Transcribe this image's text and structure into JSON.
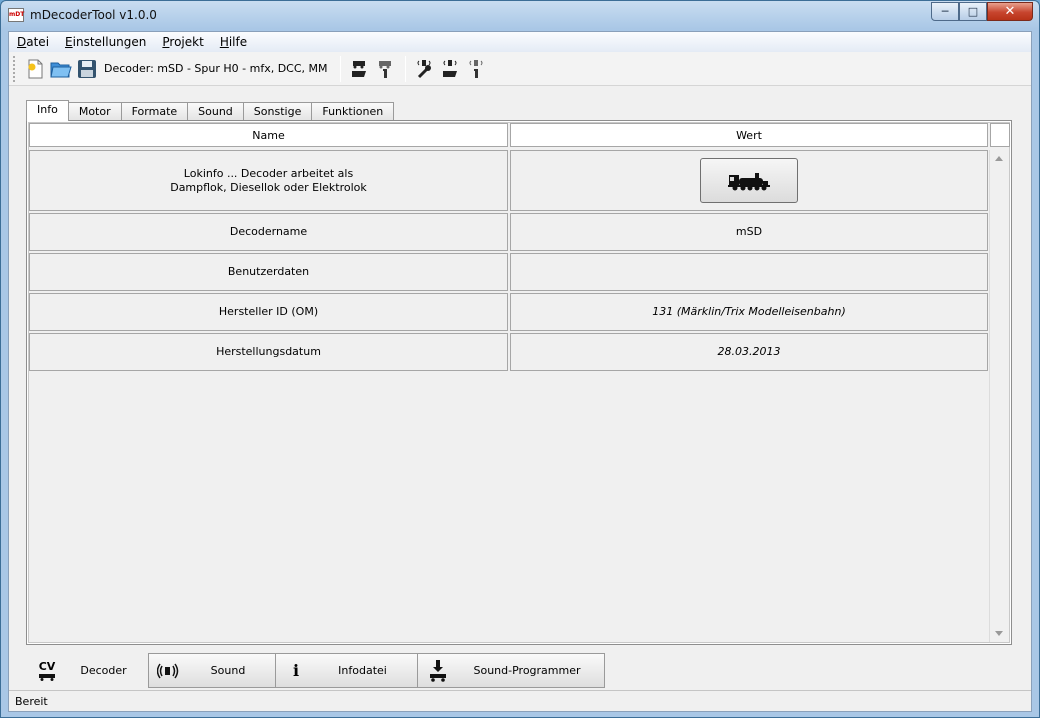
{
  "window": {
    "title": "mDecoderTool v1.0.0",
    "app_icon_text": "mDT"
  },
  "menubar": {
    "items": [
      {
        "mnemonic": "D",
        "rest": "atei"
      },
      {
        "mnemonic": "E",
        "rest": "instellungen"
      },
      {
        "mnemonic": "P",
        "rest": "rojekt"
      },
      {
        "mnemonic": "H",
        "rest": "ilfe"
      }
    ]
  },
  "toolbar": {
    "decoder_label": "Decoder: mSD - Spur H0 - mfx, DCC, MM"
  },
  "tabs": [
    "Info",
    "Motor",
    "Formate",
    "Sound",
    "Sonstige",
    "Funktionen"
  ],
  "grid": {
    "headers": {
      "name": "Name",
      "value": "Wert"
    },
    "rows": [
      {
        "name_line1": "Lokinfo ... Decoder arbeitet als",
        "name_line2": "Dampflok, Diesellok oder Elektrolok",
        "value": ""
      },
      {
        "name": "Decodername",
        "value": "mSD"
      },
      {
        "name": "Benutzerdaten",
        "value": ""
      },
      {
        "name": "Hersteller ID (OM)",
        "value": "131 (Märklin/Trix Modelleisenbahn)"
      },
      {
        "name": "Herstellungsdatum",
        "value": "28.03.2013"
      }
    ]
  },
  "bottom_tabs": [
    {
      "label": "Decoder",
      "icon_text": "CV"
    },
    {
      "label": "Sound"
    },
    {
      "label": "Infodatei",
      "icon_text": "i"
    },
    {
      "label": "Sound-Programmer"
    }
  ],
  "status": {
    "text": "Bereit"
  }
}
